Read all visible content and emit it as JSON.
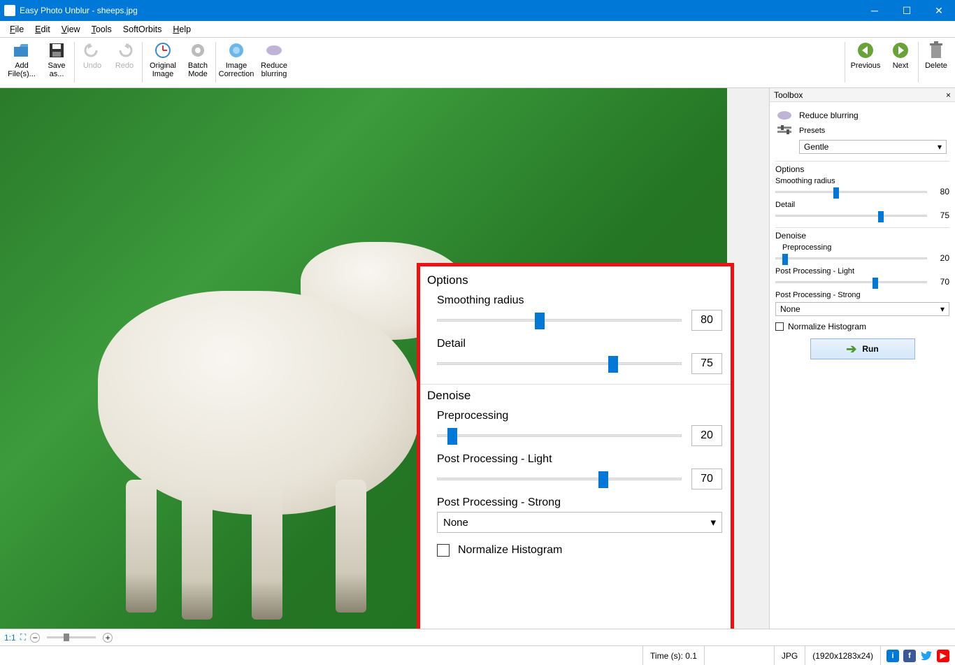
{
  "window": {
    "title": "Easy Photo Unblur - sheeps.jpg"
  },
  "menu": {
    "file": "File",
    "edit": "Edit",
    "view": "View",
    "tools": "Tools",
    "softorbits": "SoftOrbits",
    "help": "Help"
  },
  "toolbar": {
    "add": "Add File(s)...",
    "save": "Save as...",
    "undo": "Undo",
    "redo": "Redo",
    "original": "Original Image",
    "batch": "Batch Mode",
    "correction": "Image Correction",
    "reduce": "Reduce blurring",
    "previous": "Previous",
    "next": "Next",
    "delete": "Delete"
  },
  "overlay": {
    "options_title": "Options",
    "smoothing_label": "Smoothing radius",
    "smoothing_value": "80",
    "detail_label": "Detail",
    "detail_value": "75",
    "denoise_title": "Denoise",
    "pre_label": "Preprocessing",
    "pre_value": "20",
    "postlight_label": "Post Processing - Light",
    "postlight_value": "70",
    "poststrong_label": "Post Processing - Strong",
    "poststrong_value": "None",
    "normalize_label": "Normalize Histogram"
  },
  "sidebar": {
    "title": "Toolbox",
    "effect": "Reduce blurring",
    "presets_label": "Presets",
    "presets_value": "Gentle",
    "options_title": "Options",
    "smoothing_label": "Smoothing radius",
    "smoothing_value": "80",
    "detail_label": "Detail",
    "detail_value": "75",
    "denoise_title": "Denoise",
    "pre_label": "Preprocessing",
    "pre_value": "20",
    "postlight_label": "Post Processing - Light",
    "postlight_value": "70",
    "poststrong_label": "Post Processing - Strong",
    "poststrong_value": "None",
    "normalize_label": "Normalize Histogram",
    "run": "Run"
  },
  "status": {
    "zoom": "1:1",
    "time": "Time (s): 0.1",
    "format": "JPG",
    "dims": "(1920x1283x24)"
  }
}
